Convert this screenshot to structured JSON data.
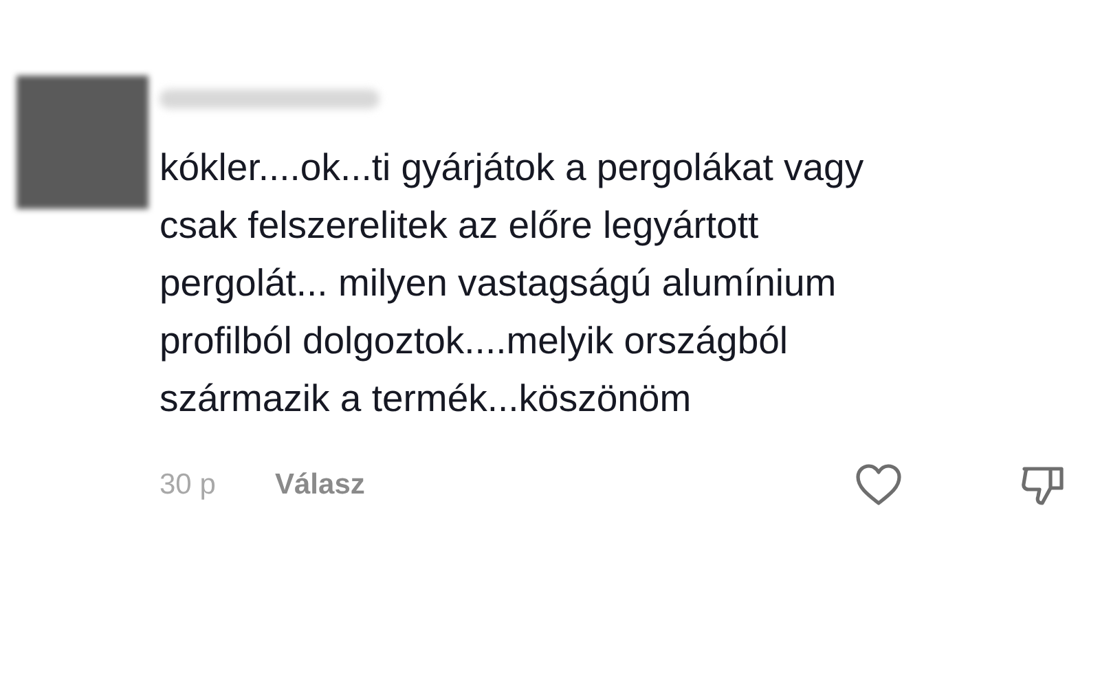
{
  "comment": {
    "text_lines": [
      "kókler....ok...ti gyárjátok a pergolákat vagy",
      "csak felszerelitek az előre legyártott",
      "pergolát... milyen vastagságú alumínium",
      "profilból dolgoztok....melyik országból",
      "származik a termék...köszönöm"
    ],
    "time": "30 p",
    "reply": "Válasz"
  }
}
